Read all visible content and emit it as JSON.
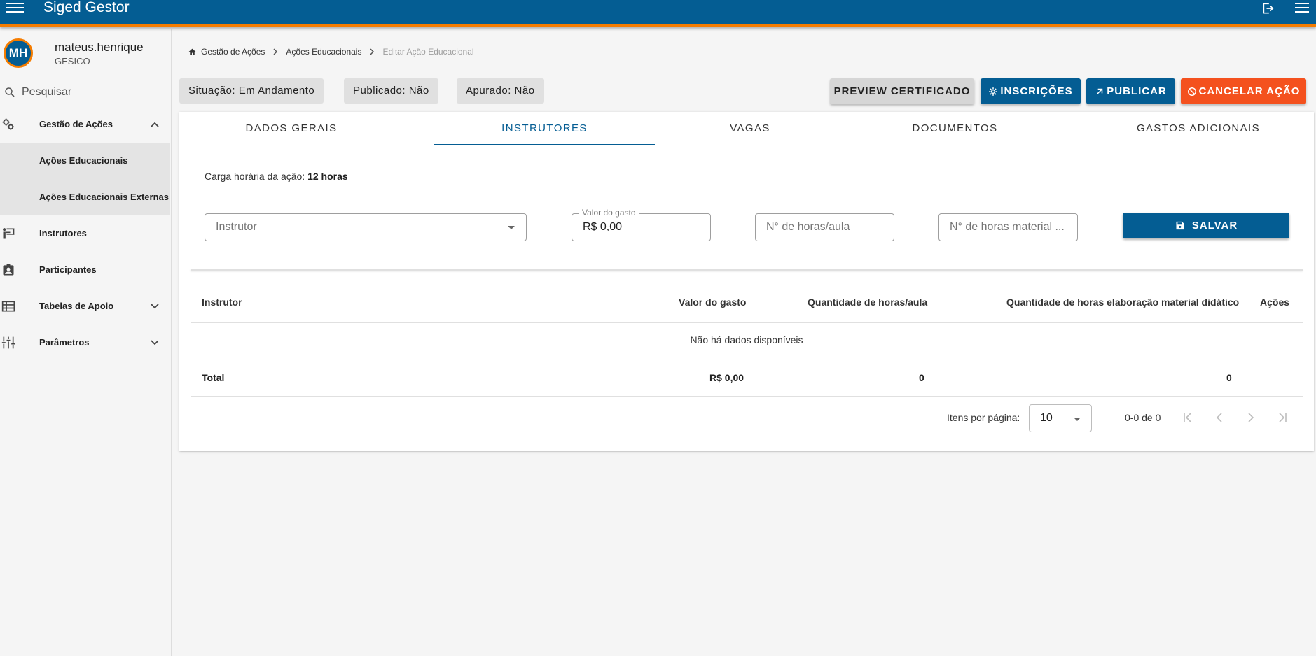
{
  "topbar": {
    "title": "Siged Gestor",
    "menu_icon": "menu-icon",
    "logout_icon": "logout-icon",
    "right_menu_icon": "menu-icon"
  },
  "user": {
    "initials": "MH",
    "name": "mateus.henrique",
    "org": "GESICO"
  },
  "search": {
    "placeholder": "Pesquisar"
  },
  "sidebar": {
    "items": [
      {
        "label": "Gestão de Ações",
        "icon": "gears-icon",
        "expanded": true
      },
      {
        "label": "Instrutores",
        "icon": "instructor-icon"
      },
      {
        "label": "Participantes",
        "icon": "badge-icon"
      },
      {
        "label": "Tabelas de Apoio",
        "icon": "table-icon",
        "expanded": false
      },
      {
        "label": "Parâmetros",
        "icon": "tune-icon",
        "expanded": false
      }
    ],
    "subitems": [
      {
        "label": "Ações Educacionais"
      },
      {
        "label": "Ações Educacionais Externas"
      }
    ]
  },
  "breadcrumb": {
    "items": [
      "Gestão de Ações",
      "Ações Educacionais"
    ],
    "current": "Editar Ação Educacional"
  },
  "status": {
    "situacao": "Situação: Em Andamento",
    "publicado": "Publicado: Não",
    "apurado": "Apurado: Não"
  },
  "actions": {
    "preview": "PREVIEW CERTIFICADO",
    "inscricoes": "INSCRIÇÕES",
    "publicar": "PUBLICAR",
    "cancelar": "CANCELAR AÇÃO"
  },
  "tabs": [
    "DADOS GERAIS",
    "INSTRUTORES",
    "VAGAS",
    "DOCUMENTOS",
    "GASTOS ADICIONAIS"
  ],
  "active_tab": "INSTRUTORES",
  "carga": {
    "label": "Carga horária da ação:",
    "value": "12 horas"
  },
  "form": {
    "instrutor_placeholder": "Instrutor",
    "valor_label": "Valor do gasto",
    "valor_value": "R$ 0,00",
    "horas_aula_placeholder": "N° de horas/aula",
    "horas_material_placeholder": "N° de horas material ...",
    "salvar": "SALVAR"
  },
  "table": {
    "headers": [
      "Instrutor",
      "Valor do gasto",
      "Quantidade de horas/aula",
      "Quantidade de horas elaboração material didático",
      "Ações"
    ],
    "empty": "Não há dados disponíveis",
    "total": {
      "label": "Total",
      "valor": "R$ 0,00",
      "horas_aula": "0",
      "horas_material": "0"
    }
  },
  "paginator": {
    "label": "Itens por página:",
    "page_size": "10",
    "range": "0-0 de 0"
  },
  "colors": {
    "primary": "#045d93",
    "accent": "#f57c00",
    "danger": "#f4511e"
  }
}
